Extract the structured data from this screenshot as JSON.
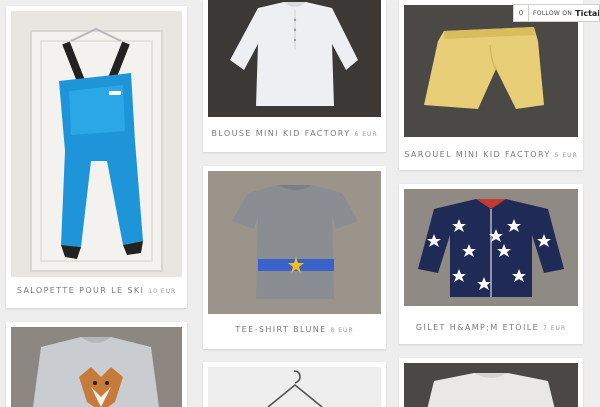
{
  "follow_widget": {
    "count": "0",
    "label": "FOLLOW ON",
    "brand": "Tictail"
  },
  "items": [
    {
      "title": "SALOPETTE POUR LE SKI",
      "price": "10 EUR",
      "image": "blue-ski-overalls"
    },
    {
      "title": "BLOUSE MINI KID FACTORY",
      "price": "6 EUR",
      "image": "white-blouse"
    },
    {
      "title": "SAROUEL MINI KID FACTORY",
      "price": "5 EUR",
      "image": "yellow-harem-pants"
    },
    {
      "title": "TEE-SHIRT BLUNE",
      "price": "8 EUR",
      "image": "grey-tshirt-star"
    },
    {
      "title": "GILET H&AMP;M ETOILE",
      "price": "7 EUR",
      "image": "navy-star-cardigan"
    },
    {
      "title": "",
      "price": "",
      "image": "grey-fox-sweater"
    },
    {
      "title": "",
      "price": "",
      "image": "hanger-garment"
    },
    {
      "title": "",
      "price": "",
      "image": "white-top"
    }
  ],
  "colors": {
    "background": "#eeeeee",
    "card": "#ffffff",
    "caption": "#7a7a7a"
  }
}
